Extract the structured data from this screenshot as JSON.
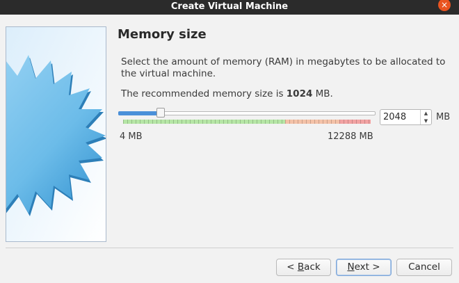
{
  "window": {
    "title": "Create Virtual Machine",
    "close_glyph": "×"
  },
  "page": {
    "heading": "Memory size",
    "description": "Select the amount of memory (RAM) in megabytes to be allocated to the virtual machine.",
    "recommend_prefix": "The recommended memory size is ",
    "recommend_value": "1024",
    "recommend_suffix": " MB."
  },
  "memory": {
    "value": "2048",
    "value_mb": 2048,
    "min_mb": 4,
    "max_mb": 12288,
    "unit": "MB",
    "min_label": "4 MB",
    "max_label": "12288 MB",
    "zones": [
      {
        "name": "safe",
        "fraction": 0.655,
        "color": "#b6e6a6"
      },
      {
        "name": "warning",
        "fraction": 0.22,
        "color": "#f4c2a8"
      },
      {
        "name": "danger",
        "fraction": 0.125,
        "color": "#f2a3a3"
      }
    ],
    "accent_color": "#4a90d9"
  },
  "buttons": {
    "back_prefix": "< ",
    "back_mnemonic": "B",
    "back_rest": "ack",
    "next_mnemonic": "N",
    "next_rest": "ext >",
    "cancel": "Cancel"
  },
  "icons": {
    "close": "close-icon",
    "side_image": "starburst-illustration"
  }
}
